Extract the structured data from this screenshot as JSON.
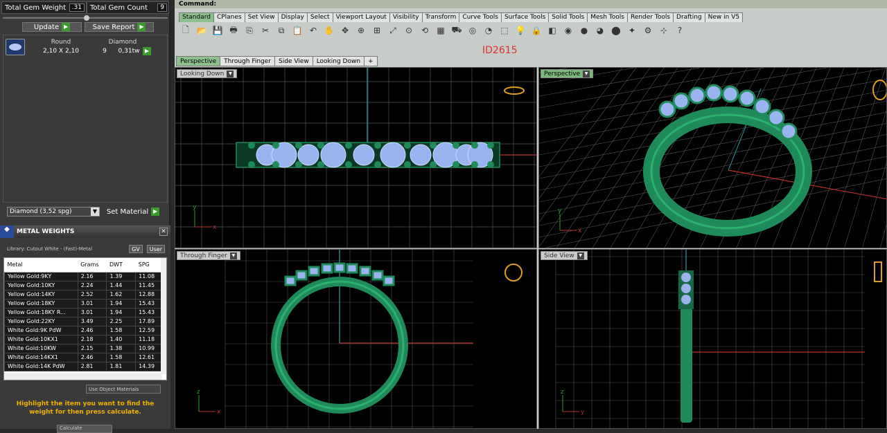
{
  "left_panel": {
    "total_gem_weight_label": "Total Gem Weight",
    "total_gem_weight_value": ".31",
    "total_gem_count_label": "Total Gem Count",
    "total_gem_count_value": "9",
    "update_label": "Update",
    "save_report_label": "Save Report",
    "gem": {
      "shape": "Round",
      "type": "Diamond",
      "size": "2,10 X 2,10",
      "count": "9",
      "weight": "0,31tw"
    },
    "material_select": "Diamond    (3,52 spg)",
    "set_material_label": "Set Material"
  },
  "metal_weights": {
    "title": "METAL WEIGHTS",
    "library": "Library: Cutout White - (Fast)-Metal",
    "tag_gv": "GV",
    "tag_user": "User",
    "columns": [
      "Metal",
      "Grams",
      "DWT",
      "SPG"
    ],
    "rows": [
      [
        "Yellow Gold:9KY",
        "2.16",
        "1.39",
        "11.08"
      ],
      [
        "Yellow Gold:10KY",
        "2.24",
        "1.44",
        "11.45"
      ],
      [
        "Yellow Gold:14KY",
        "2.52",
        "1.62",
        "12.88"
      ],
      [
        "Yellow Gold:18KY",
        "3.01",
        "1.94",
        "15.43"
      ],
      [
        "Yellow Gold:18KY R...",
        "3.01",
        "1.94",
        "15.43"
      ],
      [
        "Yellow Gold:22KY",
        "3.49",
        "2.25",
        "17.89"
      ],
      [
        "White Gold:9K PdW",
        "2.46",
        "1.58",
        "12.59"
      ],
      [
        "White Gold:10KX1",
        "2.18",
        "1.40",
        "11.18"
      ],
      [
        "White Gold:10KW",
        "2.15",
        "1.38",
        "10.99"
      ],
      [
        "White Gold:14KX1",
        "2.46",
        "1.58",
        "12.61"
      ],
      [
        "White Gold:14K PdW",
        "2.81",
        "1.81",
        "14.39"
      ]
    ],
    "use_object_materials": "Use Object Materials",
    "hint": "Highlight the item you want to find the weight for then press calculate.",
    "calculate_label": "Calculate"
  },
  "main": {
    "command_label": "Command:",
    "tabs": [
      "Standard",
      "CPlanes",
      "Set View",
      "Display",
      "Select",
      "Viewport Layout",
      "Visibility",
      "Transform",
      "Curve Tools",
      "Surface Tools",
      "Solid Tools",
      "Mesh Tools",
      "Render Tools",
      "Drafting",
      "New in V5"
    ],
    "id_label": "ID2615",
    "viewport_tabs": [
      "Perspective",
      "Through Finger",
      "Side View",
      "Looking Down",
      "+"
    ],
    "viewports": {
      "top_left": "Looking Down",
      "top_right": "Perspective",
      "bottom_left": "Through Finger",
      "bottom_right": "Side View"
    },
    "axes": {
      "x": "x",
      "y": "y",
      "z": "z"
    }
  },
  "colors": {
    "ring_green": "#1f8a5a",
    "gem_blue": "#9ab4f0",
    "grid": "#555555",
    "accent_green": "#3a9a2a",
    "hint_orange": "#f0b000",
    "id_red": "#e03030"
  }
}
